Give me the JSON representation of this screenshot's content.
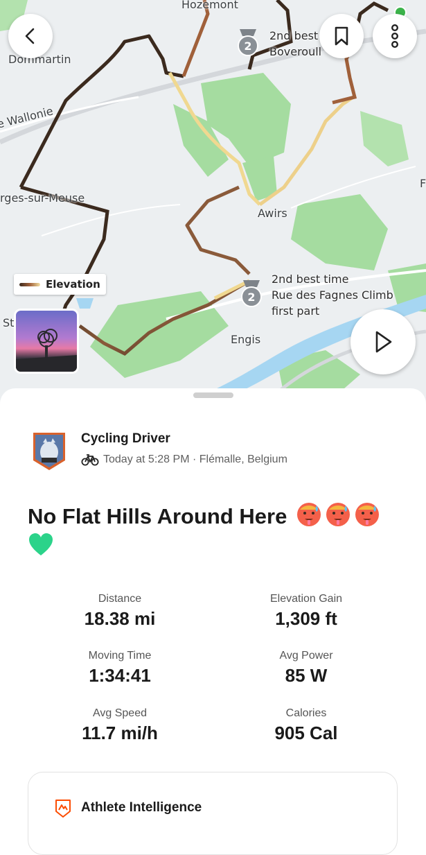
{
  "map": {
    "labels": [
      "Hozemont",
      "Dommartin",
      "e Wallonie",
      "rges-sur-Meuse",
      "Awirs",
      "Engis",
      "St",
      "F"
    ],
    "legend_label": "Elevation",
    "segments": [
      {
        "medal_rank": "2",
        "line1": "2nd best",
        "line2": "Boveroull"
      },
      {
        "medal_rank": "2",
        "line1": "2nd best time",
        "line2": "Rue des Fagnes Climb",
        "line3": "first part"
      }
    ],
    "icons": [
      "back-arrow-icon",
      "bookmark-icon",
      "more-vertical-icon",
      "play-icon"
    ]
  },
  "activity": {
    "athlete_name": "Cycling Driver",
    "meta": "Today at 5:28 PM · Flémalle, Belgium",
    "sport_icon": "bike-icon",
    "title": "No Flat Hills Around Here",
    "title_emojis": [
      "hot-face",
      "hot-face",
      "hot-face",
      "green-heart"
    ]
  },
  "stats": [
    {
      "label": "Distance",
      "value": "18.38 mi"
    },
    {
      "label": "Elevation Gain",
      "value": "1,309 ft"
    },
    {
      "label": "Moving Time",
      "value": "1:34:41"
    },
    {
      "label": "Avg Power",
      "value": "85 W"
    },
    {
      "label": "Avg Speed",
      "value": "11.7 mi/h"
    },
    {
      "label": "Calories",
      "value": "905 Cal"
    }
  ],
  "insights": {
    "title": "Athlete Intelligence"
  },
  "colors": {
    "route_dark": "#3b2a1e",
    "route_mid": "#a0603a",
    "route_light": "#f0d890",
    "park": "#9fdc9c",
    "water": "#a6d6f2",
    "brand": "#fc4c02"
  }
}
